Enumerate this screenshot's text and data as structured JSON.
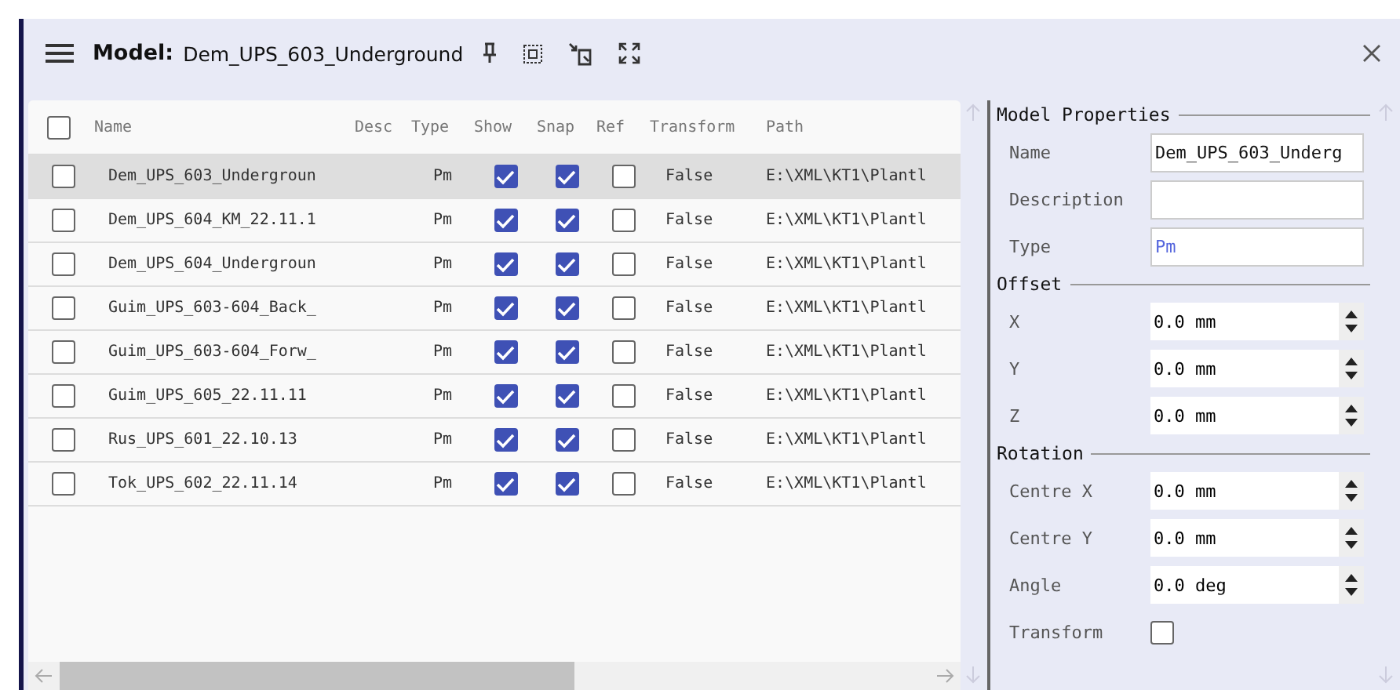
{
  "header": {
    "label": "Model:",
    "model_name": "Dem_UPS_603_Underground"
  },
  "table": {
    "all_checked": false,
    "columns": [
      "Name",
      "Desc",
      "Type",
      "Show",
      "Snap",
      "Ref",
      "Transform",
      "Path"
    ],
    "rows": [
      {
        "name": "Dem_UPS_603_Undergroun",
        "type": "Pm",
        "show": true,
        "snap": true,
        "ref": false,
        "transform": "False",
        "path": "E:\\XML\\KT1\\Plantl",
        "checked": false,
        "selected": true
      },
      {
        "name": "Dem_UPS_604_KM_22.11.1",
        "type": "Pm",
        "show": true,
        "snap": true,
        "ref": false,
        "transform": "False",
        "path": "E:\\XML\\KT1\\Plantl",
        "checked": false,
        "selected": false
      },
      {
        "name": "Dem_UPS_604_Undergroun",
        "type": "Pm",
        "show": true,
        "snap": true,
        "ref": false,
        "transform": "False",
        "path": "E:\\XML\\KT1\\Plantl",
        "checked": false,
        "selected": false
      },
      {
        "name": "Guim_UPS_603-604_Back_",
        "type": "Pm",
        "show": true,
        "snap": true,
        "ref": false,
        "transform": "False",
        "path": "E:\\XML\\KT1\\Plantl",
        "checked": false,
        "selected": false
      },
      {
        "name": "Guim_UPS_603-604_Forw_",
        "type": "Pm",
        "show": true,
        "snap": true,
        "ref": false,
        "transform": "False",
        "path": "E:\\XML\\KT1\\Plantl",
        "checked": false,
        "selected": false
      },
      {
        "name": "Guim_UPS_605_22.11.11",
        "type": "Pm",
        "show": true,
        "snap": true,
        "ref": false,
        "transform": "False",
        "path": "E:\\XML\\KT1\\Plantl",
        "checked": false,
        "selected": false
      },
      {
        "name": "Rus_UPS_601_22.10.13",
        "type": "Pm",
        "show": true,
        "snap": true,
        "ref": false,
        "transform": "False",
        "path": "E:\\XML\\KT1\\Plantl",
        "checked": false,
        "selected": false
      },
      {
        "name": "Tok_UPS_602_22.11.14",
        "type": "Pm",
        "show": true,
        "snap": true,
        "ref": false,
        "transform": "False",
        "path": "E:\\XML\\KT1\\Plantl",
        "checked": false,
        "selected": false
      }
    ]
  },
  "properties": [
    {
      "title": "Model Properties",
      "fields": [
        {
          "kind": "text",
          "label": "Name",
          "value": "Dem_UPS_603_Underg"
        },
        {
          "kind": "text",
          "label": "Description"
        },
        {
          "kind": "accent-text",
          "label": "Type",
          "value": "Pm"
        }
      ]
    },
    {
      "title": "Offset",
      "fields": [
        {
          "kind": "spin",
          "label": "X",
          "value": "0.0 mm"
        },
        {
          "kind": "spin",
          "label": "Y",
          "value": "0.0 mm"
        },
        {
          "kind": "spin",
          "label": "Z",
          "value": "0.0 mm"
        }
      ]
    },
    {
      "title": "Rotation",
      "fields": [
        {
          "kind": "spin",
          "label": "Centre X",
          "value": "0.0 mm"
        },
        {
          "kind": "spin",
          "label": "Centre Y",
          "value": "0.0 mm"
        },
        {
          "kind": "spin",
          "label": "Angle",
          "value": "0.0 deg"
        },
        {
          "kind": "checkbox",
          "label": "Transform",
          "checked": false
        }
      ]
    }
  ]
}
